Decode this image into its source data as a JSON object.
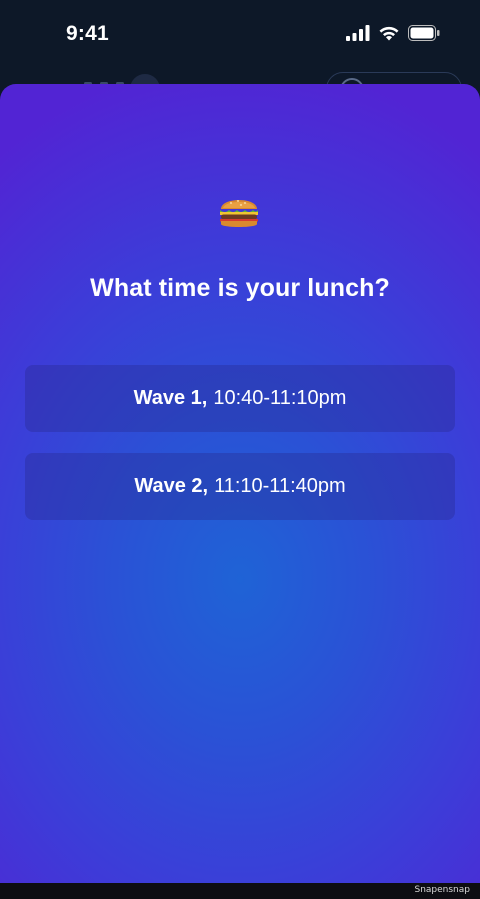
{
  "status_bar": {
    "time": "9:41",
    "icons": [
      "cellular-signal-icon",
      "wifi-icon",
      "battery-icon"
    ]
  },
  "prompt": {
    "emoji": "hamburger",
    "question": "What time is your lunch?"
  },
  "options": [
    {
      "label": "Wave 1,",
      "time": "10:40-11:10pm"
    },
    {
      "label": "Wave 2,",
      "time": "11:10-11:40pm"
    }
  ],
  "footer": {
    "watermark": "Snapensnap"
  }
}
